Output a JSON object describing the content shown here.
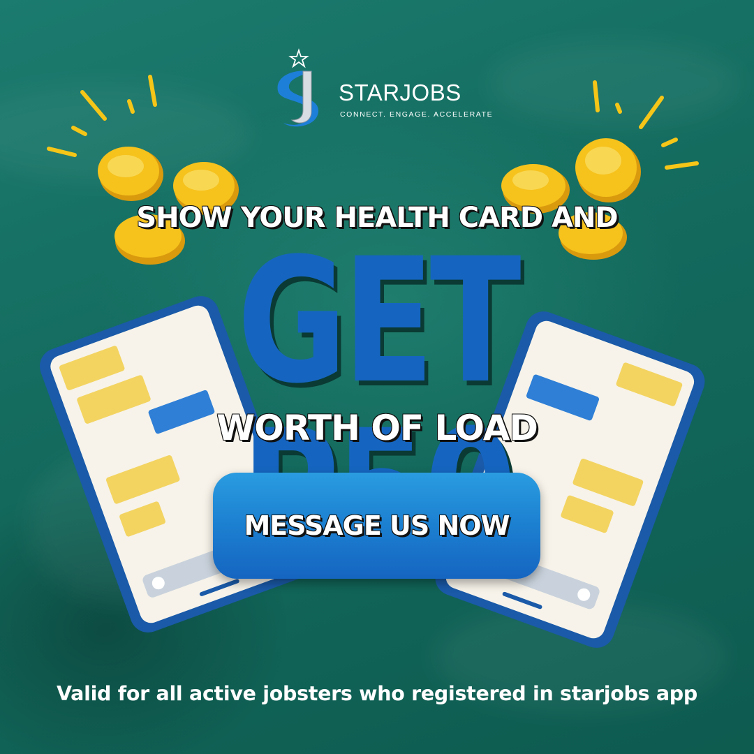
{
  "brand": {
    "name": "STARJOBS",
    "tagline": "CONNECT. ENGAGE. ACCELERATE"
  },
  "headline": {
    "top": "SHOW YOUR HEALTH CARD AND",
    "amount": "GET P50",
    "bottom": "WORTH OF LOAD"
  },
  "cta": {
    "label": "MESSAGE US NOW"
  },
  "footnote": "Valid for all active jobsters who registered in starjobs app",
  "colors": {
    "background": "#136a5d",
    "amount_blue": "#1565c0",
    "button_blue": "#1d82d2",
    "coin_gold": "#f6c21c",
    "chat_bubble": "#f3d461"
  },
  "icons": {
    "logo": "starjobs-logo",
    "coins": "gold-coin-icon",
    "phones": "smartphone-chat-icon"
  }
}
